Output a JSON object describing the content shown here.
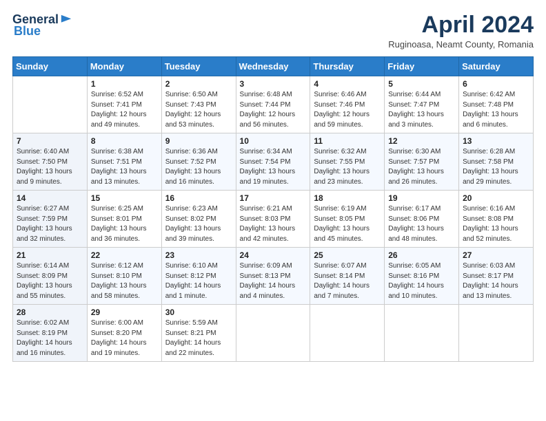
{
  "header": {
    "logo_general": "General",
    "logo_blue": "Blue",
    "title": "April 2024",
    "location": "Ruginoasa, Neamt County, Romania"
  },
  "weekdays": [
    "Sunday",
    "Monday",
    "Tuesday",
    "Wednesday",
    "Thursday",
    "Friday",
    "Saturday"
  ],
  "weeks": [
    [
      {
        "day": "",
        "info": ""
      },
      {
        "day": "1",
        "info": "Sunrise: 6:52 AM\nSunset: 7:41 PM\nDaylight: 12 hours\nand 49 minutes."
      },
      {
        "day": "2",
        "info": "Sunrise: 6:50 AM\nSunset: 7:43 PM\nDaylight: 12 hours\nand 53 minutes."
      },
      {
        "day": "3",
        "info": "Sunrise: 6:48 AM\nSunset: 7:44 PM\nDaylight: 12 hours\nand 56 minutes."
      },
      {
        "day": "4",
        "info": "Sunrise: 6:46 AM\nSunset: 7:46 PM\nDaylight: 12 hours\nand 59 minutes."
      },
      {
        "day": "5",
        "info": "Sunrise: 6:44 AM\nSunset: 7:47 PM\nDaylight: 13 hours\nand 3 minutes."
      },
      {
        "day": "6",
        "info": "Sunrise: 6:42 AM\nSunset: 7:48 PM\nDaylight: 13 hours\nand 6 minutes."
      }
    ],
    [
      {
        "day": "7",
        "info": "Sunrise: 6:40 AM\nSunset: 7:50 PM\nDaylight: 13 hours\nand 9 minutes."
      },
      {
        "day": "8",
        "info": "Sunrise: 6:38 AM\nSunset: 7:51 PM\nDaylight: 13 hours\nand 13 minutes."
      },
      {
        "day": "9",
        "info": "Sunrise: 6:36 AM\nSunset: 7:52 PM\nDaylight: 13 hours\nand 16 minutes."
      },
      {
        "day": "10",
        "info": "Sunrise: 6:34 AM\nSunset: 7:54 PM\nDaylight: 13 hours\nand 19 minutes."
      },
      {
        "day": "11",
        "info": "Sunrise: 6:32 AM\nSunset: 7:55 PM\nDaylight: 13 hours\nand 23 minutes."
      },
      {
        "day": "12",
        "info": "Sunrise: 6:30 AM\nSunset: 7:57 PM\nDaylight: 13 hours\nand 26 minutes."
      },
      {
        "day": "13",
        "info": "Sunrise: 6:28 AM\nSunset: 7:58 PM\nDaylight: 13 hours\nand 29 minutes."
      }
    ],
    [
      {
        "day": "14",
        "info": "Sunrise: 6:27 AM\nSunset: 7:59 PM\nDaylight: 13 hours\nand 32 minutes."
      },
      {
        "day": "15",
        "info": "Sunrise: 6:25 AM\nSunset: 8:01 PM\nDaylight: 13 hours\nand 36 minutes."
      },
      {
        "day": "16",
        "info": "Sunrise: 6:23 AM\nSunset: 8:02 PM\nDaylight: 13 hours\nand 39 minutes."
      },
      {
        "day": "17",
        "info": "Sunrise: 6:21 AM\nSunset: 8:03 PM\nDaylight: 13 hours\nand 42 minutes."
      },
      {
        "day": "18",
        "info": "Sunrise: 6:19 AM\nSunset: 8:05 PM\nDaylight: 13 hours\nand 45 minutes."
      },
      {
        "day": "19",
        "info": "Sunrise: 6:17 AM\nSunset: 8:06 PM\nDaylight: 13 hours\nand 48 minutes."
      },
      {
        "day": "20",
        "info": "Sunrise: 6:16 AM\nSunset: 8:08 PM\nDaylight: 13 hours\nand 52 minutes."
      }
    ],
    [
      {
        "day": "21",
        "info": "Sunrise: 6:14 AM\nSunset: 8:09 PM\nDaylight: 13 hours\nand 55 minutes."
      },
      {
        "day": "22",
        "info": "Sunrise: 6:12 AM\nSunset: 8:10 PM\nDaylight: 13 hours\nand 58 minutes."
      },
      {
        "day": "23",
        "info": "Sunrise: 6:10 AM\nSunset: 8:12 PM\nDaylight: 14 hours\nand 1 minute."
      },
      {
        "day": "24",
        "info": "Sunrise: 6:09 AM\nSunset: 8:13 PM\nDaylight: 14 hours\nand 4 minutes."
      },
      {
        "day": "25",
        "info": "Sunrise: 6:07 AM\nSunset: 8:14 PM\nDaylight: 14 hours\nand 7 minutes."
      },
      {
        "day": "26",
        "info": "Sunrise: 6:05 AM\nSunset: 8:16 PM\nDaylight: 14 hours\nand 10 minutes."
      },
      {
        "day": "27",
        "info": "Sunrise: 6:03 AM\nSunset: 8:17 PM\nDaylight: 14 hours\nand 13 minutes."
      }
    ],
    [
      {
        "day": "28",
        "info": "Sunrise: 6:02 AM\nSunset: 8:19 PM\nDaylight: 14 hours\nand 16 minutes."
      },
      {
        "day": "29",
        "info": "Sunrise: 6:00 AM\nSunset: 8:20 PM\nDaylight: 14 hours\nand 19 minutes."
      },
      {
        "day": "30",
        "info": "Sunrise: 5:59 AM\nSunset: 8:21 PM\nDaylight: 14 hours\nand 22 minutes."
      },
      {
        "day": "",
        "info": ""
      },
      {
        "day": "",
        "info": ""
      },
      {
        "day": "",
        "info": ""
      },
      {
        "day": "",
        "info": ""
      }
    ]
  ]
}
